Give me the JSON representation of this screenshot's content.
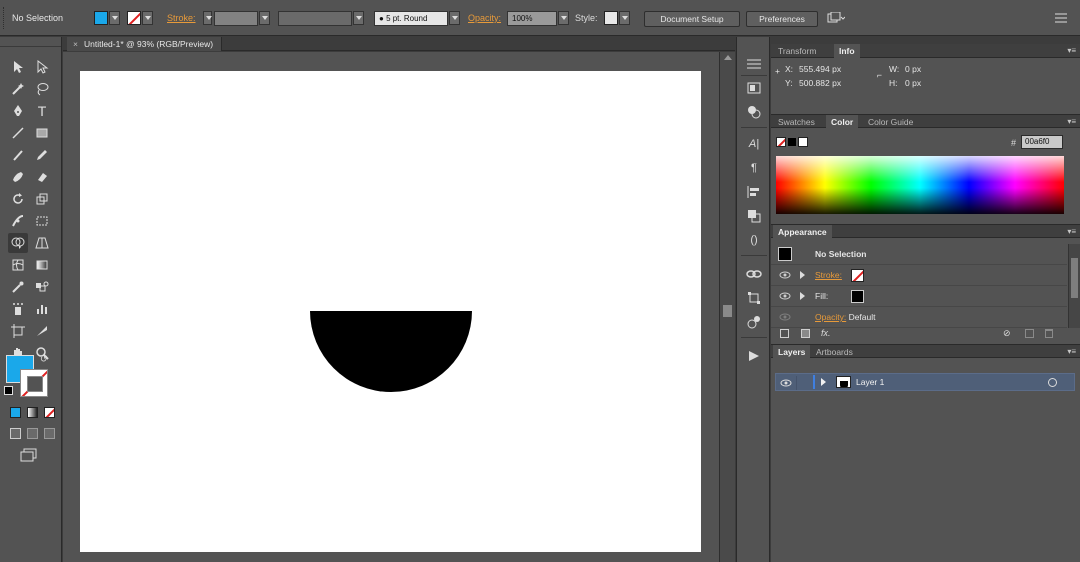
{
  "control_bar": {
    "selection_label": "No Selection",
    "fill_color": "#1aa8ea",
    "stroke_label": "Stroke:",
    "brush_label": "5 pt. Round",
    "opacity_label": "Opacity:",
    "opacity_value": "100%",
    "style_label": "Style:",
    "document_setup": "Document Setup",
    "preferences": "Preferences"
  },
  "document": {
    "tab_title": "Untitled-1* @ 93% (RGB/Preview)",
    "tab_close": "×"
  },
  "artwork": {
    "shape": "half-circle",
    "fill": "#000000"
  },
  "tools": {
    "type_tool": "T",
    "fill_color": "#1aa8ea",
    "stroke_color": "none"
  },
  "info_panel": {
    "tabs": [
      "Transform",
      "Info"
    ],
    "active_tab": "Info",
    "x_label": "X:",
    "x_value": "555.494 px",
    "y_label": "Y:",
    "y_value": "500.882 px",
    "w_label": "W:",
    "w_value": "0 px",
    "h_label": "H:",
    "h_value": "0 px"
  },
  "color_panel": {
    "tabs": [
      "Swatches",
      "Color",
      "Color Guide"
    ],
    "active_tab": "Color",
    "hex_prefix": "#",
    "hex_value": "00a6f0"
  },
  "appearance_panel": {
    "title": "Appearance",
    "selection": "No Selection",
    "stroke_label": "Stroke:",
    "fill_label": "Fill:",
    "opacity_label": "Opacity:",
    "opacity_value": "Default",
    "fx_label": "fx."
  },
  "layers_panel": {
    "tabs": [
      "Layers",
      "Artboards"
    ],
    "active_tab": "Layers",
    "layer_name": "Layer 1"
  }
}
